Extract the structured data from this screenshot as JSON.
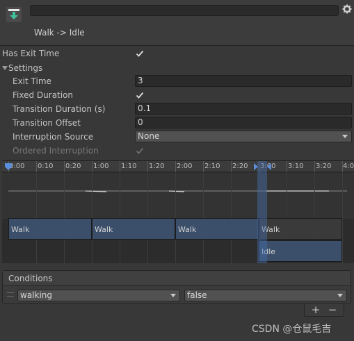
{
  "header": {
    "transition_title": "Walk -> Idle",
    "name_value": "",
    "icon": "transition-down-arrow-icon",
    "settings_icon": "gear-icon"
  },
  "properties": {
    "has_exit_time": {
      "label": "Has Exit Time",
      "checked": true
    },
    "settings_foldout": {
      "label": "Settings",
      "expanded": true
    },
    "exit_time": {
      "label": "Exit Time",
      "value": "3"
    },
    "fixed_duration": {
      "label": "Fixed Duration",
      "checked": true
    },
    "transition_duration": {
      "label": "Transition Duration (s)",
      "value": "0.1"
    },
    "transition_offset": {
      "label": "Transition Offset",
      "value": "0"
    },
    "interruption_source": {
      "label": "Interruption Source",
      "value": "None"
    },
    "ordered_interruption": {
      "label": "Ordered Interruption",
      "checked": true,
      "disabled": true
    }
  },
  "timeline": {
    "ticks": [
      "0:00",
      "0:10",
      "0:20",
      "1:00",
      "1:10",
      "1:20",
      "2:00",
      "2:10",
      "2:20",
      "3:00",
      "3:10",
      "3:20",
      "4:0"
    ],
    "clips_row1": [
      "Walk",
      "Walk",
      "Walk",
      "Walk"
    ],
    "clips_row2": [
      "Idle"
    ]
  },
  "conditions": {
    "title": "Conditions",
    "items": [
      {
        "parameter": "walking",
        "value": "false"
      }
    ],
    "add_label": "+",
    "remove_label": "−"
  },
  "watermark": "CSDN @仓鼠毛吉",
  "colors": {
    "background": "#383838",
    "field": "#2a2a2a",
    "clip_blue": "#3b4f6b",
    "accent_blue": "#4a7bc8",
    "icon_green": "#3fbf9a"
  }
}
